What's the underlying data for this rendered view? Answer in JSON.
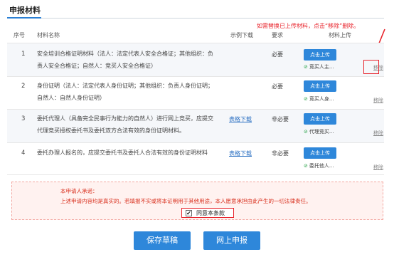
{
  "section": {
    "title": "申报材料"
  },
  "hint": {
    "text": "如需替换已上传材料，点击“移除”删除。"
  },
  "table": {
    "headers": {
      "num": "序号",
      "name": "材料名称",
      "download": "示例下载",
      "require": "要求",
      "upload": "材料上传"
    },
    "rows": [
      {
        "num": "1",
        "name": "安全培训合格证明材料（法人：法定代表人安全合格证；其他组织：负责人安全合格证；自然人：竞买人安全合格证）",
        "download": "",
        "require": "必要",
        "button": "点击上传",
        "uploaded": "竞买人主...",
        "remove": "移除"
      },
      {
        "num": "2",
        "name": "身份证明（法人：法定代表人身份证明；其他组织：负责人身份证明；自然人：自然人身份证明）",
        "download": "",
        "require": "必要",
        "button": "点击上传",
        "uploaded": "竞买人身...",
        "remove": "移除"
      },
      {
        "num": "3",
        "name": "委托代理人（具备完全民事行为能力的自然人）进行网上竞买，应提交代理竞买授权委托书及委托双方合法有效的身份证明材料。",
        "download": "表格下载",
        "require": "非必要",
        "button": "点击上传",
        "uploaded": "代理竞买...",
        "remove": "移除"
      },
      {
        "num": "4",
        "name": "委托办理人报名的，应提交委托书及委托人合法有效的身份证明材料",
        "download": "表格下载",
        "require": "非必要",
        "button": "点击上传",
        "uploaded": "委托他人...",
        "remove": "移除"
      }
    ]
  },
  "pledge": {
    "title": "本申请人承诺：",
    "text": "上述申请内容均是真实的。若填报不实或将本证明用于其他用途，本人愿意承担由此产生的一切法律责任。",
    "checkbox_label": "同意本条款",
    "checked": true
  },
  "actions": {
    "save_label": "保存草稿",
    "submit_label": "网上申报"
  },
  "colors": {
    "accent": "#2e87da",
    "alert": "#e8232b",
    "success": "#35a853"
  },
  "icons": {
    "uploaded": "check-circle-icon",
    "checkbox": "checkmark-icon"
  }
}
